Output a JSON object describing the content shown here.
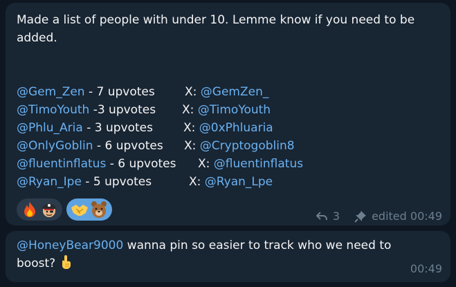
{
  "message1": {
    "intro": "Made a list of people with under 10. Lemme know if you need to be added.",
    "entries": [
      {
        "handle": "@Gem_Zen",
        "votes": " - 7 upvotes",
        "x_label": "X: ",
        "x_handle": "@GemZen_"
      },
      {
        "handle": "@TimoYouth",
        "votes": " -3 upvotes",
        "x_label": "X: ",
        "x_handle": "@TimoYouth"
      },
      {
        "handle": "@Phlu_Aria",
        "votes": " - 3 upvotes",
        "x_label": "X: ",
        "x_handle": "@0xPhluaria"
      },
      {
        "handle": "@OnlyGoblin",
        "votes": " - 6 upvotes",
        "x_label": "X: ",
        "x_handle": "@Cryptogoblin8"
      },
      {
        "handle": "@fluentinflatus",
        "votes": " - 6 upvotes",
        "x_label": "X: ",
        "x_handle": "@fluentinflatus"
      },
      {
        "handle": "@Ryan_Ipe",
        "votes": " - 5 upvotes",
        "x_label": "X: ",
        "x_handle": "@Ryan_Lpe"
      }
    ],
    "reactions": [
      {
        "icons": [
          "fire-emoji",
          "pirate-emoji"
        ],
        "chosen": false
      },
      {
        "icons": [
          "handshake-emoji",
          "bear-emoji"
        ],
        "chosen": true
      }
    ],
    "replies": "3",
    "edited_time": "edited 00:49"
  },
  "message2": {
    "mention": "@HoneyBear9000",
    "text": " wanna pin so easier to track who we need to boost? ",
    "emoji": "point-up-emoji",
    "time": "00:49"
  },
  "colors": {
    "background": "#0e1621",
    "bubble": "#182533",
    "link": "#6ab2f2",
    "meta": "#6d7f8f",
    "chosen_reaction": "#5fa2e0"
  }
}
